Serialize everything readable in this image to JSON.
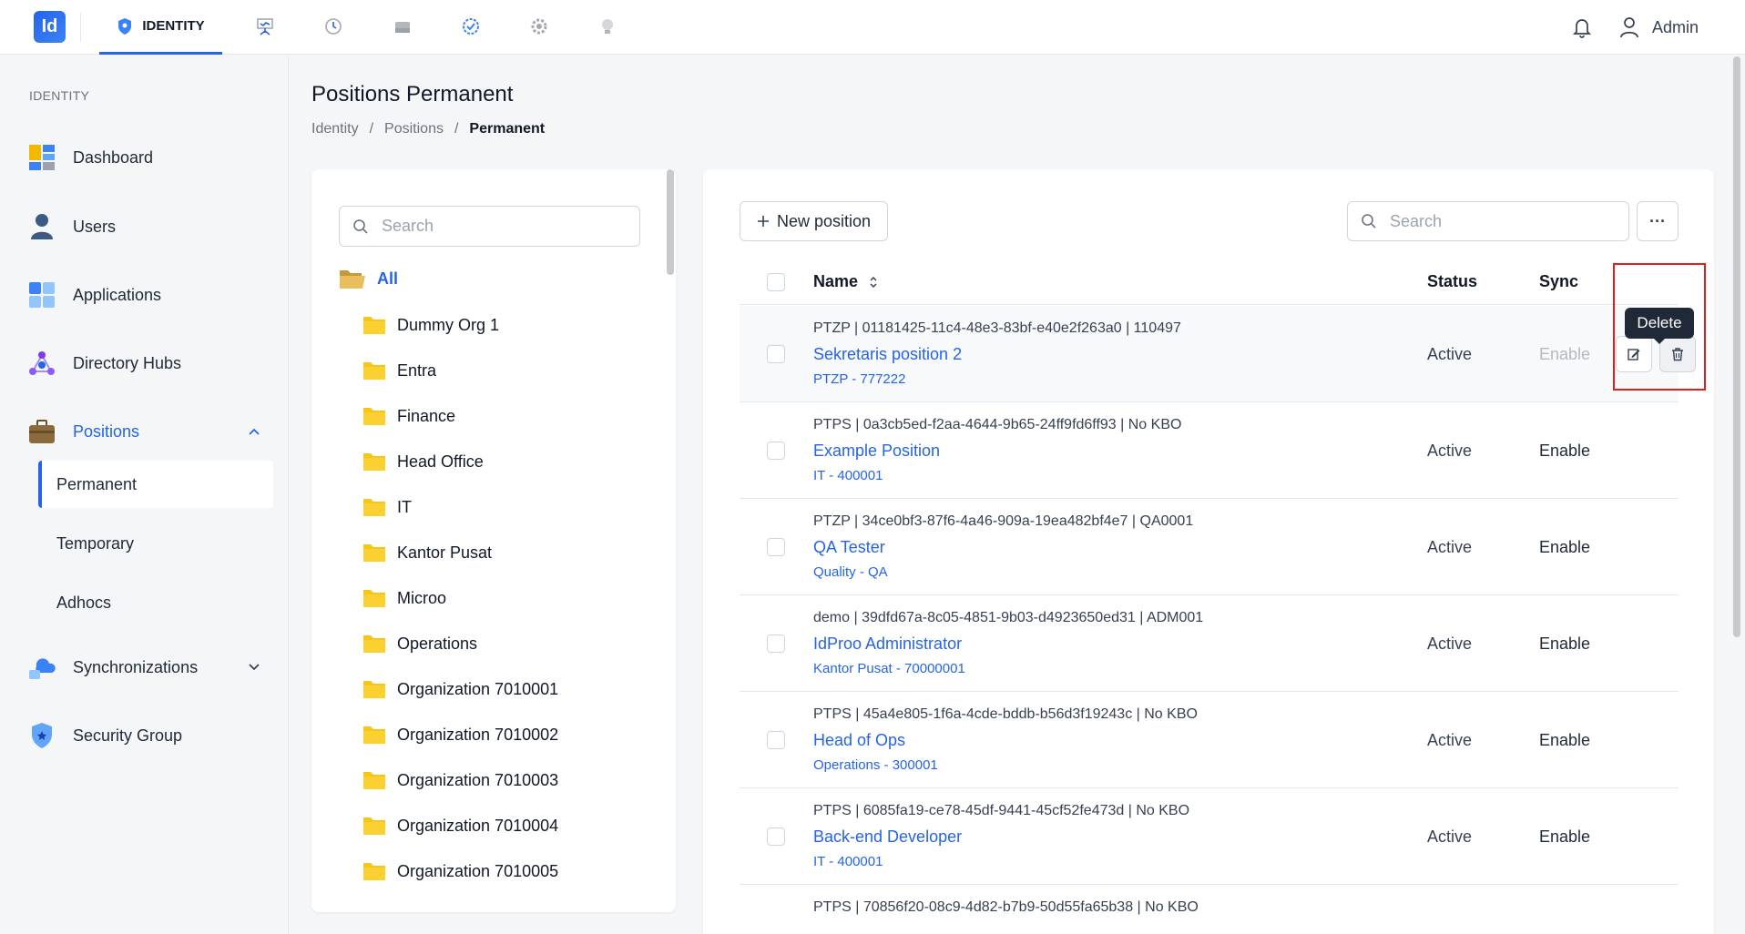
{
  "app": {
    "logo_text": "Id",
    "active_module": "IDENTITY",
    "top_icons": [
      "shield-icon",
      "presentation-icon",
      "history-icon",
      "storage-icon",
      "verified-badge-icon",
      "settings-gear-icon",
      "lightbulb-icon"
    ],
    "user_name": "Admin"
  },
  "sidebar": {
    "heading": "IDENTITY",
    "items": [
      {
        "label": "Dashboard",
        "icon": "dashboard-icon"
      },
      {
        "label": "Users",
        "icon": "user-icon"
      },
      {
        "label": "Applications",
        "icon": "apps-grid-icon"
      },
      {
        "label": "Directory Hubs",
        "icon": "hub-network-icon"
      },
      {
        "label": "Positions",
        "icon": "briefcase-icon"
      },
      {
        "label": "Synchronizations",
        "icon": "cloud-sync-icon"
      },
      {
        "label": "Security Group",
        "icon": "shield-icon"
      }
    ],
    "positions_sub": [
      "Permanent",
      "Temporary",
      "Adhocs"
    ]
  },
  "page": {
    "title": "Positions Permanent",
    "breadcrumb": [
      "Identity",
      "Positions",
      "Permanent"
    ],
    "separator": "/"
  },
  "tree": {
    "search_placeholder": "Search",
    "all_label": "All",
    "folders": [
      "Dummy Org 1",
      "Entra",
      "Finance",
      "Head Office",
      "IT",
      "Kantor Pusat",
      "Microo",
      "Operations",
      "Organization 7010001",
      "Organization 7010002",
      "Organization 7010003",
      "Organization 7010004",
      "Organization 7010005"
    ]
  },
  "positions": {
    "new_button": "New position",
    "search_placeholder": "Search",
    "more_label": "···",
    "columns": {
      "name": "Name",
      "status": "Status",
      "sync": "Sync"
    },
    "rows": [
      {
        "meta": "PTZP | 01181425-11c4-48e3-83bf-e40e2f263a0 | 110497",
        "name": "Sekretaris position 2",
        "sub": "PTZP - 777222",
        "status": "Active",
        "sync": "Enable"
      },
      {
        "meta": "PTPS | 0a3cb5ed-f2aa-4644-9b65-24ff9fd6ff93 | No KBO",
        "name": "Example Position",
        "sub": "IT - 400001",
        "status": "Active",
        "sync": "Enable"
      },
      {
        "meta": "PTZP | 34ce0bf3-87f6-4a46-909a-19ea482bf4e7 | QA0001",
        "name": "QA Tester",
        "sub": "Quality - QA",
        "status": "Active",
        "sync": "Enable"
      },
      {
        "meta": "demo | 39dfd67a-8c05-4851-9b03-d4923650ed31 | ADM001",
        "name": "IdProo Administrator",
        "sub": "Kantor Pusat - 70000001",
        "status": "Active",
        "sync": "Enable"
      },
      {
        "meta": "PTPS | 45a4e805-1f6a-4cde-bddb-b56d3f19243c | No KBO",
        "name": "Head of Ops",
        "sub": "Operations - 300001",
        "status": "Active",
        "sync": "Enable"
      },
      {
        "meta": "PTPS | 6085fa19-ce78-45df-9441-45cf52fe473d | No KBO",
        "name": "Back-end Developer",
        "sub": "IT - 400001",
        "status": "Active",
        "sync": "Enable"
      },
      {
        "meta": "PTPS | 70856f20-08c9-4d82-b7b9-50d55fa65b38 | No KBO",
        "name": "",
        "sub": "",
        "status": "",
        "sync": ""
      }
    ],
    "tooltip": "Delete"
  },
  "colors": {
    "accent": "#2563eb",
    "folder": "#f5c518",
    "highlight": "#e11d1d"
  }
}
